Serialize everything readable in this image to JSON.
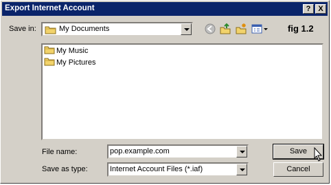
{
  "window": {
    "title": "Export Internet Account",
    "help_button": "?",
    "close_button": "X"
  },
  "toolbar": {
    "save_in_label": "Save in:",
    "save_in_value": "My Documents",
    "back_icon": "back-arrow-icon",
    "up_icon": "up-folder-icon",
    "new_folder_icon": "new-folder-icon",
    "views_icon": "views-menu-icon",
    "figure_label": "fig 1.2"
  },
  "files": [
    {
      "name": "My Music",
      "icon": "folder-icon"
    },
    {
      "name": "My Pictures",
      "icon": "folder-icon"
    }
  ],
  "form": {
    "file_name_label": "File name:",
    "file_name_value": "pop.example.com",
    "save_as_type_label": "Save as type:",
    "save_as_type_value": "Internet Account Files (*.iaf)"
  },
  "buttons": {
    "save": "Save",
    "cancel": "Cancel"
  },
  "colors": {
    "titlebar": "#0a246a",
    "dialog_face": "#d4d0c8",
    "folder": "#f2d36b"
  }
}
